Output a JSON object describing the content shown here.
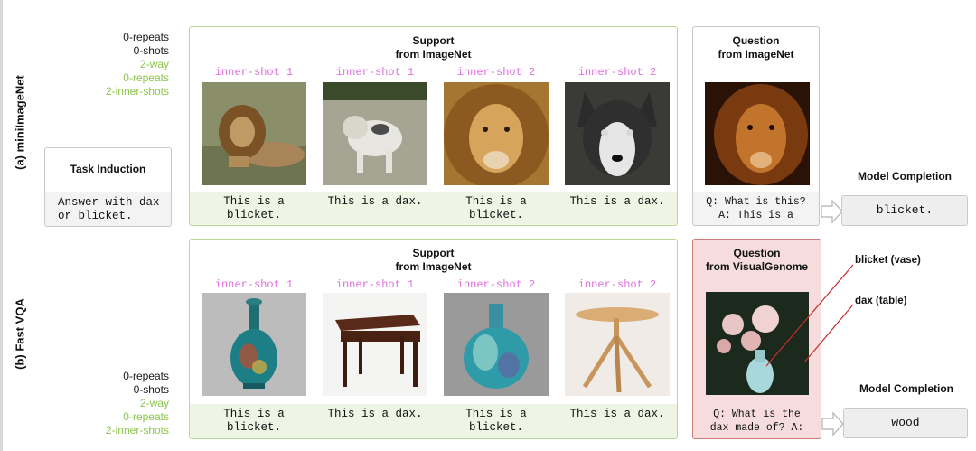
{
  "rows": {
    "a_label": "(a) miniImageNet",
    "b_label": "(b) Fast VQA"
  },
  "meta_a": {
    "line1": "0-repeats",
    "line2": "0-shots",
    "line3": "2-way",
    "line4": "0-repeats",
    "line5": "2-inner-shots"
  },
  "meta_b": {
    "line1": "0-repeats",
    "line2": "0-shots",
    "line3": "2-way",
    "line4": "0-repeats",
    "line5": "2-inner-shots"
  },
  "task": {
    "title": "Task Induction",
    "line1": "Answer with dax",
    "line2": "or blicket."
  },
  "support_a": {
    "title1": "Support",
    "title2": "from ImageNet",
    "shots": [
      {
        "label": "inner-shot 1",
        "cap1": "This is a",
        "cap2": "blicket.",
        "image": "lion-lying"
      },
      {
        "label": "inner-shot 1",
        "cap1": "This is a dax.",
        "cap2": "",
        "image": "dog-walking"
      },
      {
        "label": "inner-shot 2",
        "cap1": "This is a",
        "cap2": "blicket.",
        "image": "lion-face"
      },
      {
        "label": "inner-shot 2",
        "cap1": "This is a dax.",
        "cap2": "",
        "image": "husky-face"
      }
    ]
  },
  "question_a": {
    "title1": "Question",
    "title2": "from ImageNet",
    "line1": "Q: What is this?",
    "line2": "A: This is a",
    "image": "lion-portrait"
  },
  "completion_a": {
    "title": "Model Completion",
    "value": "blicket."
  },
  "support_b": {
    "title1": "Support",
    "title2": "from ImageNet",
    "shots": [
      {
        "label": "inner-shot 1",
        "cap1": "This is a",
        "cap2": "blicket.",
        "image": "vase-ornate"
      },
      {
        "label": "inner-shot 1",
        "cap1": "This is a dax.",
        "cap2": "",
        "image": "wooden-table"
      },
      {
        "label": "inner-shot 2",
        "cap1": "This is a",
        "cap2": "blicket.",
        "image": "vase-glass"
      },
      {
        "label": "inner-shot 2",
        "cap1": "This is a dax.",
        "cap2": "",
        "image": "round-table"
      }
    ]
  },
  "question_b": {
    "title1": "Question",
    "title2": "from VisualGenome",
    "line1": "Q: What is the",
    "line2": "dax made of? A:",
    "image": "flowers-in-vase",
    "anno1": "blicket (vase)",
    "anno2": "dax (table)"
  },
  "completion_b": {
    "title": "Model Completion",
    "value": "wood"
  },
  "colors": {
    "support_fill": "#eef5e4",
    "support_border": "#b9d997",
    "question_vqa_fill": "#f6dcdc",
    "question_vqa_border": "#d07a7a",
    "shot_label": "#e06fe0",
    "meta_green": "#8cc44d",
    "annotation_line": "#cc2a2a"
  }
}
